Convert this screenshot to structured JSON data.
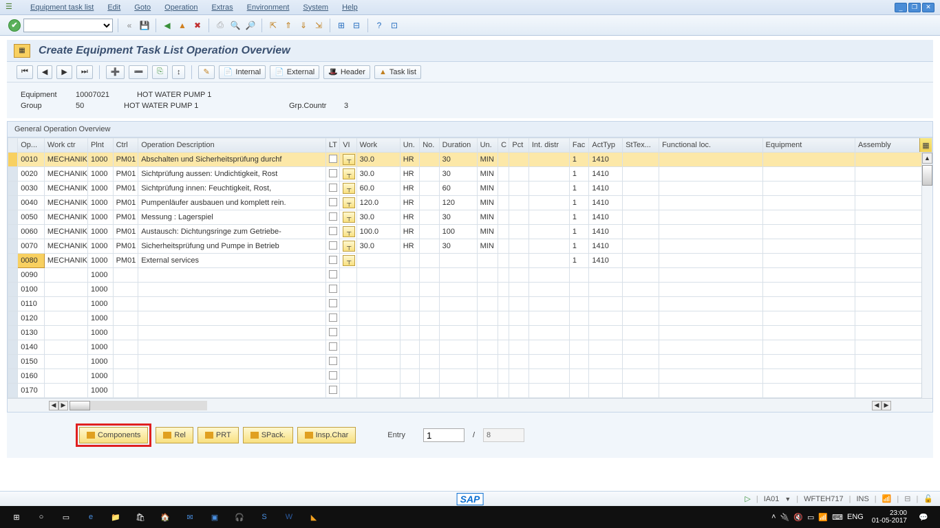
{
  "menu": {
    "items": [
      "Equipment task list",
      "Edit",
      "Goto",
      "Operation",
      "Extras",
      "Environment",
      "System",
      "Help"
    ]
  },
  "page_title": "Create Equipment Task List Operation Overview",
  "subtoolbar": {
    "internal": "Internal",
    "external": "External",
    "header": "Header",
    "tasklist": "Task list"
  },
  "info": {
    "equipment_lbl": "Equipment",
    "equipment_no": "10007021",
    "equipment_desc": "HOT WATER PUMP 1",
    "group_lbl": "Group",
    "group_no": "50",
    "group_desc": "HOT WATER PUMP 1",
    "grp_countr_lbl": "Grp.Countr",
    "grp_countr": "3"
  },
  "section_title": "General Operation Overview",
  "columns": {
    "op": "Op...",
    "workctr": "Work ctr",
    "plnt": "Plnt",
    "ctrl": "Ctrl",
    "desc": "Operation Description",
    "lt": "LT",
    "vi": "VI",
    "work": "Work",
    "un1": "Un.",
    "no": "No.",
    "dur": "Duration",
    "un2": "Un.",
    "c": "C",
    "pct": "Pct",
    "intdistr": "Int. distr",
    "fac": "Fac",
    "acttyp": "ActTyp",
    "sttex": "StTex...",
    "funcloc": "Functional loc.",
    "equip": "Equipment",
    "assembly": "Assembly"
  },
  "rows": [
    {
      "op": "0010",
      "wc": "MECHANIK",
      "plnt": "1000",
      "ctrl": "PM01",
      "desc": "Abschalten und Sicherheitsprüfung durchf",
      "work": "30.0",
      "u1": "HR",
      "dur": "30",
      "u2": "MIN",
      "fac": "1",
      "act": "1410",
      "sel": true
    },
    {
      "op": "0020",
      "wc": "MECHANIK",
      "plnt": "1000",
      "ctrl": "PM01",
      "desc": "Sichtprüfung aussen: Undichtigkeit, Rost",
      "work": "30.0",
      "u1": "HR",
      "dur": "30",
      "u2": "MIN",
      "fac": "1",
      "act": "1410"
    },
    {
      "op": "0030",
      "wc": "MECHANIK",
      "plnt": "1000",
      "ctrl": "PM01",
      "desc": "Sichtprüfung innen: Feuchtigkeit, Rost,",
      "work": "60.0",
      "u1": "HR",
      "dur": "60",
      "u2": "MIN",
      "fac": "1",
      "act": "1410"
    },
    {
      "op": "0040",
      "wc": "MECHANIK",
      "plnt": "1000",
      "ctrl": "PM01",
      "desc": "Pumpenläufer ausbauen und komplett rein.",
      "work": "120.0",
      "u1": "HR",
      "dur": "120",
      "u2": "MIN",
      "fac": "1",
      "act": "1410"
    },
    {
      "op": "0050",
      "wc": "MECHANIK",
      "plnt": "1000",
      "ctrl": "PM01",
      "desc": "Messung : Lagerspiel",
      "work": "30.0",
      "u1": "HR",
      "dur": "30",
      "u2": "MIN",
      "fac": "1",
      "act": "1410"
    },
    {
      "op": "0060",
      "wc": "MECHANIK",
      "plnt": "1000",
      "ctrl": "PM01",
      "desc": "Austausch: Dichtungsringe zum Getriebe-",
      "work": "100.0",
      "u1": "HR",
      "dur": "100",
      "u2": "MIN",
      "fac": "1",
      "act": "1410"
    },
    {
      "op": "0070",
      "wc": "MECHANIK",
      "plnt": "1000",
      "ctrl": "PM01",
      "desc": "Sicherheitsprüfung und Pumpe in Betrieb",
      "work": "30.0",
      "u1": "HR",
      "dur": "30",
      "u2": "MIN",
      "fac": "1",
      "act": "1410"
    },
    {
      "op": "0080",
      "wc": "MECHANIK",
      "plnt": "1000",
      "ctrl": "PM01",
      "desc": "External services",
      "work": "",
      "u1": "",
      "dur": "",
      "u2": "",
      "fac": "1",
      "act": "1410",
      "opsel": true
    },
    {
      "op": "0090",
      "wc": "",
      "plnt": "1000",
      "ctrl": "",
      "desc": ""
    },
    {
      "op": "0100",
      "wc": "",
      "plnt": "1000",
      "ctrl": "",
      "desc": ""
    },
    {
      "op": "0110",
      "wc": "",
      "plnt": "1000",
      "ctrl": "",
      "desc": ""
    },
    {
      "op": "0120",
      "wc": "",
      "plnt": "1000",
      "ctrl": "",
      "desc": ""
    },
    {
      "op": "0130",
      "wc": "",
      "plnt": "1000",
      "ctrl": "",
      "desc": ""
    },
    {
      "op": "0140",
      "wc": "",
      "plnt": "1000",
      "ctrl": "",
      "desc": ""
    },
    {
      "op": "0150",
      "wc": "",
      "plnt": "1000",
      "ctrl": "",
      "desc": ""
    },
    {
      "op": "0160",
      "wc": "",
      "plnt": "1000",
      "ctrl": "",
      "desc": ""
    },
    {
      "op": "0170",
      "wc": "",
      "plnt": "1000",
      "ctrl": "",
      "desc": ""
    }
  ],
  "tabs": {
    "components": "Components",
    "rel": "Rel",
    "prt": "PRT",
    "spack": "SPack.",
    "inspchar": "Insp.Char"
  },
  "entry": {
    "label": "Entry",
    "current": "1",
    "sep": "/",
    "total": "8"
  },
  "status": {
    "tcode": "IA01",
    "sys": "WFTEH717",
    "mode": "INS"
  },
  "taskbar": {
    "lang": "ENG",
    "time": "23:00",
    "date": "01-05-2017"
  }
}
